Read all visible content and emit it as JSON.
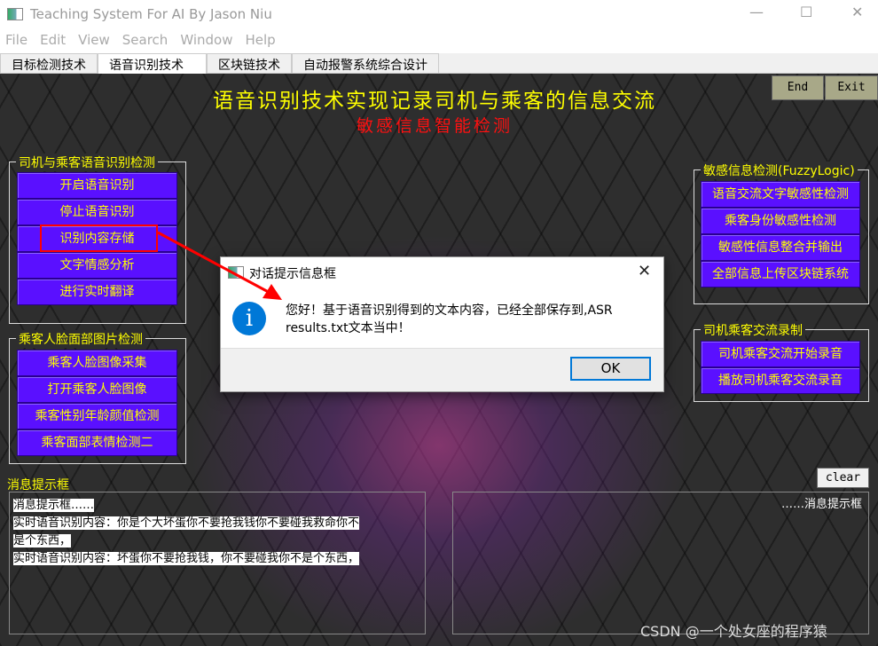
{
  "window": {
    "title": "Teaching System For AI By Jason Niu"
  },
  "menu": [
    "File",
    "Edit",
    "View",
    "Search",
    "Window",
    "Help"
  ],
  "tabs": [
    "目标检测技术",
    "语音识别技术",
    "区块链技术",
    "自动报警系统综合设计"
  ],
  "header": {
    "title": "语音识别技术实现记录司机与乘客的信息交流",
    "subtitle": "敏感信息智能检测"
  },
  "top_buttons": {
    "end": "End",
    "exit": "Exit"
  },
  "left_groups": [
    {
      "title": "司机与乘客语音识别检测",
      "buttons": [
        "开启语音识别",
        "停止语音识别",
        "识别内容存储",
        "文字情感分析",
        "进行实时翻译"
      ]
    },
    {
      "title": "乘客人脸面部图片检测",
      "buttons": [
        "乘客人脸图像采集",
        "打开乘客人脸图像",
        "乘客性别年龄颜值检测",
        "乘客面部表情检测二"
      ]
    }
  ],
  "right_groups": [
    {
      "title": "敏感信息检测(FuzzyLogic)",
      "buttons": [
        "语音交流文字敏感性检测",
        "乘客身份敏感性检测",
        "敏感性信息整合并输出",
        "全部信息上传区块链系统"
      ]
    },
    {
      "title": "司机乘客交流录制",
      "buttons": [
        "司机乘客交流开始录音",
        "播放司机乘客交流录音"
      ]
    }
  ],
  "messages": {
    "label": "消息提示框",
    "clear": "clear",
    "right_text": "……消息提示框",
    "lines": [
      "消息提示框……",
      "实时语音识别内容：你是个大坏蛋你不要抢我钱你不要碰我救命你不",
      "是个东西，",
      "实时语音识别内容：坏蛋你不要抢我钱，你不要碰我你不是个东西，"
    ]
  },
  "dialog": {
    "title": "对话提示信息框",
    "message_line1": "您好！基于语音识别得到的文本内容，已经全部保存到,ASR",
    "message_line2": "results.txt文本当中！",
    "ok": "OK",
    "icon": "info-icon"
  },
  "watermark": "CSDN @一个处女座的程序猿",
  "colors": {
    "button": "#5a10ff",
    "button_text": "#ffff00",
    "highlight": "#ff0000",
    "accent": "#0078d7"
  }
}
